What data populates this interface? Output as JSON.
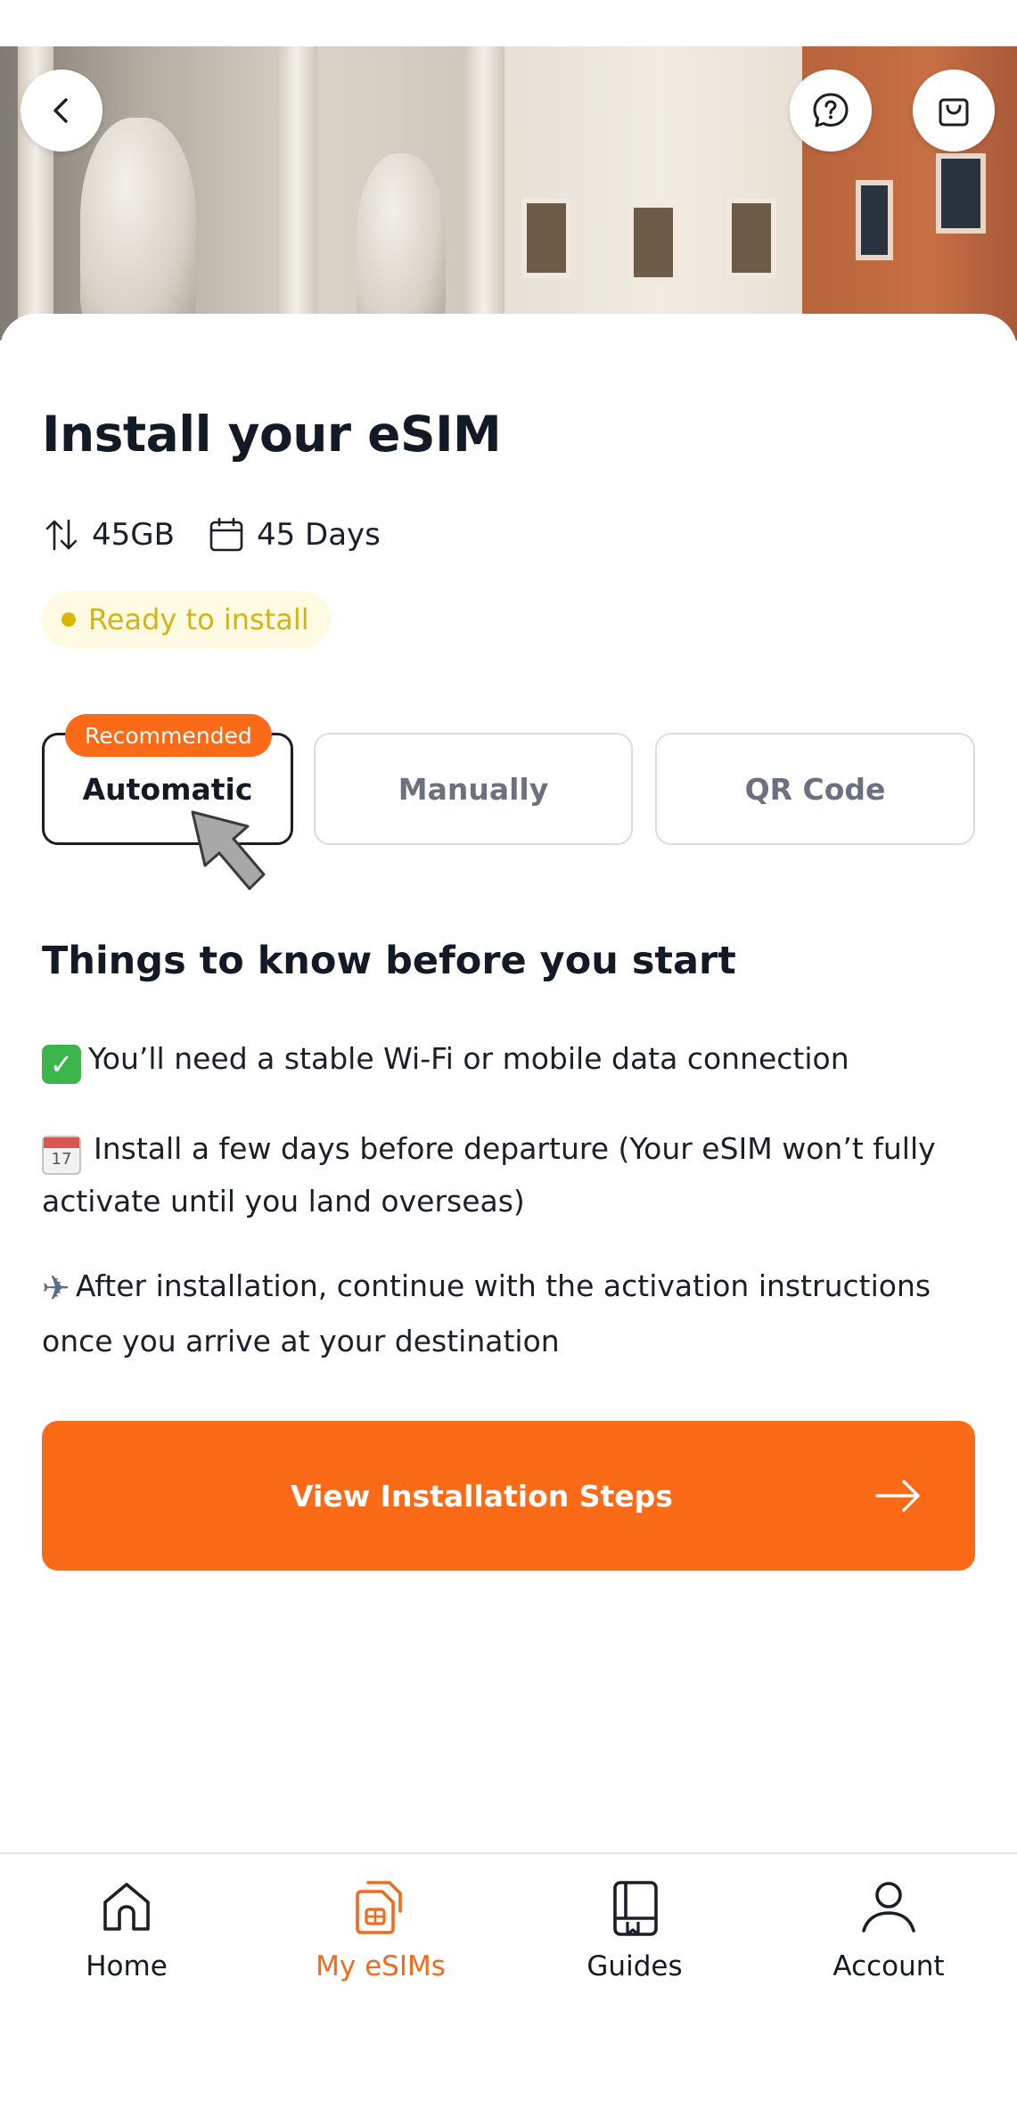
{
  "page": {
    "title": "Install your eSIM"
  },
  "plan": {
    "data_amount": "45GB",
    "duration": "45 Days",
    "status": "Ready to install"
  },
  "install_methods": {
    "recommended_badge": "Recommended",
    "tabs": [
      {
        "label": "Automatic",
        "selected": true
      },
      {
        "label": "Manually",
        "selected": false
      },
      {
        "label": "QR Code",
        "selected": false
      }
    ]
  },
  "things_to_know": {
    "title": "Things to know before you start",
    "items": [
      {
        "icon": "check-mark-emoji",
        "text": "You’ll need a stable Wi-Fi or mobile data connection"
      },
      {
        "icon": "calendar-emoji",
        "icon_text": "17",
        "text": "Install a few days before departure (Your eSIM won’t fully activate until you land overseas)"
      },
      {
        "icon": "airplane-emoji",
        "text": "After installation, continue with the activation instructions once you arrive at your destination"
      }
    ]
  },
  "cta": {
    "label": "View Installation Steps"
  },
  "bottom_nav": {
    "items": [
      {
        "label": "Home",
        "icon": "home-icon",
        "active": false
      },
      {
        "label": "My eSIMs",
        "icon": "esim-icon",
        "active": true
      },
      {
        "label": "Guides",
        "icon": "book-icon",
        "active": false
      },
      {
        "label": "Account",
        "icon": "user-icon",
        "active": false
      }
    ]
  },
  "colors": {
    "accent": "#fb6a17",
    "status_text": "#d3b316",
    "status_bg": "#fffbe3",
    "text": "#121a26"
  }
}
